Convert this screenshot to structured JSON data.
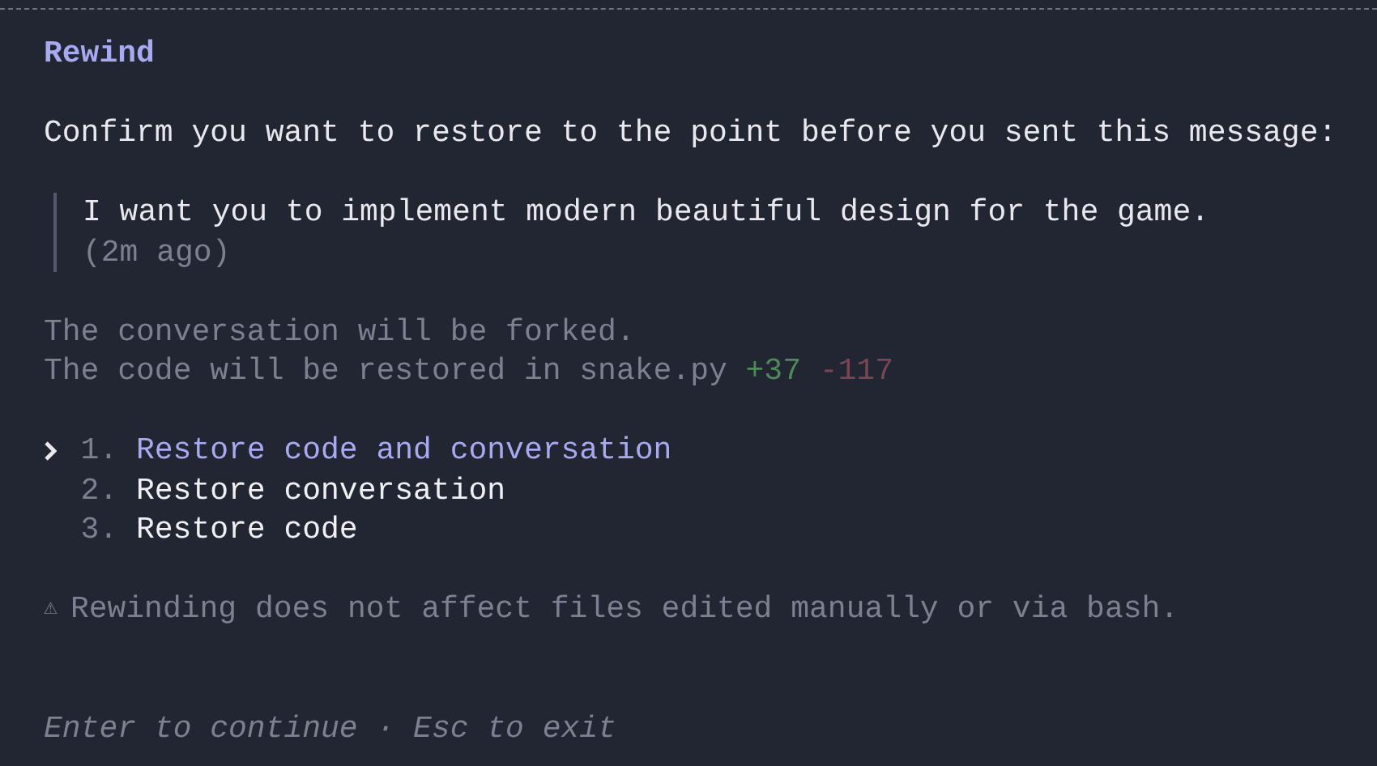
{
  "title": "Rewind",
  "prompt": "Confirm you want to restore to the point before you sent this message:",
  "quote": {
    "message": "I want you to implement modern beautiful design for the game.",
    "time": "(2m ago)"
  },
  "notes": [
    "The conversation will be forked.",
    "The code will be restored in snake.py"
  ],
  "diff": {
    "added": "+37",
    "removed": "-117"
  },
  "options": [
    {
      "number": "1.",
      "label": "Restore code and conversation",
      "selected": true
    },
    {
      "number": "2.",
      "label": "Restore conversation",
      "selected": false
    },
    {
      "number": "3.",
      "label": "Restore code",
      "selected": false
    }
  ],
  "warning": {
    "icon": "⚠",
    "text": "Rewinding does not affect files edited manually or via bash."
  },
  "footer": "Enter to continue · Esc to exit"
}
